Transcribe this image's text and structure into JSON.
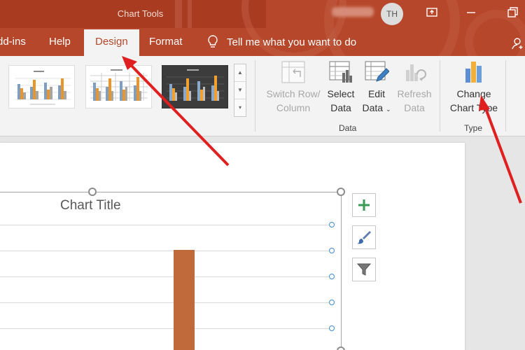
{
  "title_bar": {
    "context_label": "Chart Tools",
    "user_initials": "TH"
  },
  "tabs": [
    {
      "label": "dd-ins",
      "active": false
    },
    {
      "label": "Help",
      "active": false
    },
    {
      "label": "Design",
      "active": true
    },
    {
      "label": "Format",
      "active": false
    }
  ],
  "tell_me": {
    "placeholder": "Tell me what you want to do",
    "icon": "lightbulb-icon"
  },
  "ribbon": {
    "chart_styles": [
      "style-white-grid",
      "style-white-pattern",
      "style-dark"
    ],
    "buttons": {
      "switch_row_line1": "Switch Row/",
      "switch_row_line2": "Column",
      "select_data_line1": "Select",
      "select_data_line2": "Data",
      "edit_data_line1": "Edit",
      "edit_data_line2": "Data",
      "refresh_data_line1": "Refresh",
      "refresh_data_line2": "Data",
      "change_type_line1": "Change",
      "change_type_line2": "Chart Type"
    },
    "groups": {
      "data": "Data",
      "type": "Type"
    }
  },
  "chart": {
    "title": "Chart Title",
    "colors": {
      "gray": "#a5a5a5",
      "orange": "#c0693a"
    }
  },
  "side_buttons": [
    "chart-elements-plus-icon",
    "chart-styles-brush-icon",
    "chart-filter-icon"
  ],
  "colors": {
    "accent": "#b7472a",
    "annotation_arrow": "#e02020"
  }
}
